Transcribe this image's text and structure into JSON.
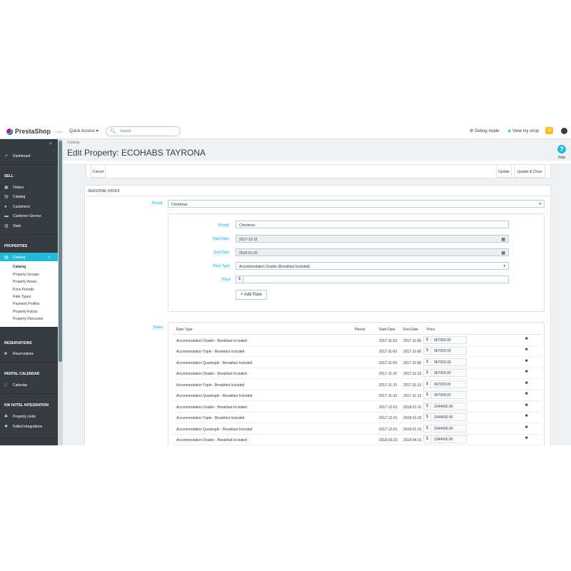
{
  "header": {
    "logo_name": "PrestaShop",
    "version": "1.7.4.2",
    "quick_access": "Quick Access ▾",
    "search_placeholder": "Search",
    "debug_mode": "Debug mode",
    "view_shop": "View my shop",
    "notif_count": "19"
  },
  "sidebar": {
    "dashboard": "Dashboard",
    "sell_title": "SELL",
    "sell_items": [
      "Orders",
      "Catalog",
      "Customers",
      "Customer Service",
      "Stats"
    ],
    "properties_title": "PROPERTIES",
    "active_item": "Catalog",
    "submenu": [
      "Catalog",
      "Property Groups",
      "Property Areas",
      "Price Periods",
      "Rate Types",
      "Payment Profiles",
      "Property Extras",
      "Property Discounts"
    ],
    "reservations_title": "RESERVATIONS",
    "reservations_item": "Reservations",
    "rental_title": "RENTAL CALENDAR",
    "rental_item": "Calendar",
    "integration_title": "KW HOTEL INTEGRATION",
    "integration_items": [
      "Property Links",
      "Failed Integrations"
    ]
  },
  "page": {
    "breadcrumb": "Catalog",
    "title": "Edit Property: ECOHABS TAYRONA",
    "help": "Help"
  },
  "toolbar": {
    "cancel": "Cancel",
    "update": "Update",
    "update_close": "Update & Close"
  },
  "seasonal": {
    "heading": "SEASONAL RATES",
    "period_label": "Period",
    "period_value": "Christmas",
    "form": {
      "period_label": "Period",
      "period_value": "Christmas",
      "start_label": "Start Date",
      "start_value": "2017-12-15",
      "end_label": "End Date",
      "end_value": "2018-01-20",
      "rate_type_label": "Rate Type",
      "rate_type_value": "Accommodation Double (Breakfast Included)",
      "price_label": "Price",
      "price_prefix": "$",
      "add_rate": "+ Add Rate"
    },
    "rates_label": "Rates",
    "table": {
      "headers": [
        "Rate Type",
        "Period",
        "Start Date",
        "End Date",
        "Price"
      ],
      "rows": [
        {
          "type": "Accommodation Double - Breakfast Included",
          "period": "",
          "start": "2017-11-03",
          "end": "2017-11-06",
          "currency": "$",
          "price": "967000.00"
        },
        {
          "type": "Accommodation Triple - Breakfast Included",
          "period": "",
          "start": "2017-11-03",
          "end": "2017-11-06",
          "currency": "$",
          "price": "967000.00"
        },
        {
          "type": "Accommodation Quadruple - Breakfast Included",
          "period": "",
          "start": "2017-11-03",
          "end": "2017-11-06",
          "currency": "$",
          "price": "967000.00"
        },
        {
          "type": "Accommodation Double - Breakfast Included",
          "period": "",
          "start": "2017-11-10",
          "end": "2017-11-13",
          "currency": "$",
          "price": "967000.00"
        },
        {
          "type": "Accommodation Triple - Breakfast Included",
          "period": "",
          "start": "2017-11-10",
          "end": "2017-11-13",
          "currency": "$",
          "price": "967000.00"
        },
        {
          "type": "Accommodation Quadruple - Breakfast Included",
          "period": "",
          "start": "2017-11-10",
          "end": "2017-11-13",
          "currency": "$",
          "price": "967000.00"
        },
        {
          "type": "Accommodation Double - Breakfast Included",
          "period": "",
          "start": "2017-12-01",
          "end": "2018-01-31",
          "currency": "$",
          "price": "1044000.00"
        },
        {
          "type": "Accommodation Triple - Breakfast Included",
          "period": "",
          "start": "2017-12-01",
          "end": "2018-01-31",
          "currency": "$",
          "price": "1044000.00"
        },
        {
          "type": "Accommodation Quadruple - Breakfast Included",
          "period": "",
          "start": "2017-12-01",
          "end": "2018-01-31",
          "currency": "$",
          "price": "1044000.00"
        },
        {
          "type": "Accommodation Double - Breakfast Included",
          "period": "",
          "start": "2018-03-23",
          "end": "2018-04-01",
          "currency": "$",
          "price": "1044000.00"
        }
      ]
    }
  },
  "colors": {
    "accent": "#25b9d7",
    "sidebar_bg": "#363a41",
    "brand_pink": "#df0067",
    "notif": "#fbbb22"
  }
}
